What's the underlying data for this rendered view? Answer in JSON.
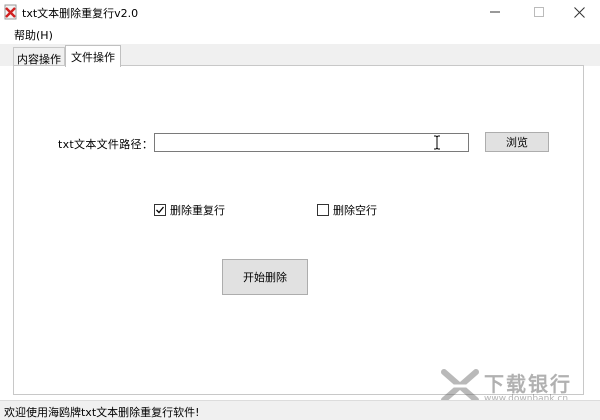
{
  "window": {
    "title": "txt文本删除重复行v2.0",
    "minimize_icon": "minimize-icon",
    "maximize_icon": "maximize-icon",
    "close_icon": "close-icon"
  },
  "menu": {
    "help": "帮助(H)"
  },
  "tabs": [
    {
      "label": "内容操作",
      "active": false
    },
    {
      "label": "文件操作",
      "active": true
    }
  ],
  "form": {
    "path_label": "txt文本文件路径：",
    "path_value": "",
    "browse_label": "浏览",
    "remove_duplicates_label": "删除重复行",
    "remove_duplicates_checked": true,
    "remove_empty_label": "删除空行",
    "remove_empty_checked": false,
    "start_label": "开始删除"
  },
  "status": {
    "text": "欢迎使用海鸥牌txt文本删除重复行软件!"
  },
  "watermark": {
    "title": "下载银行",
    "url": "www.downbank.cn"
  }
}
